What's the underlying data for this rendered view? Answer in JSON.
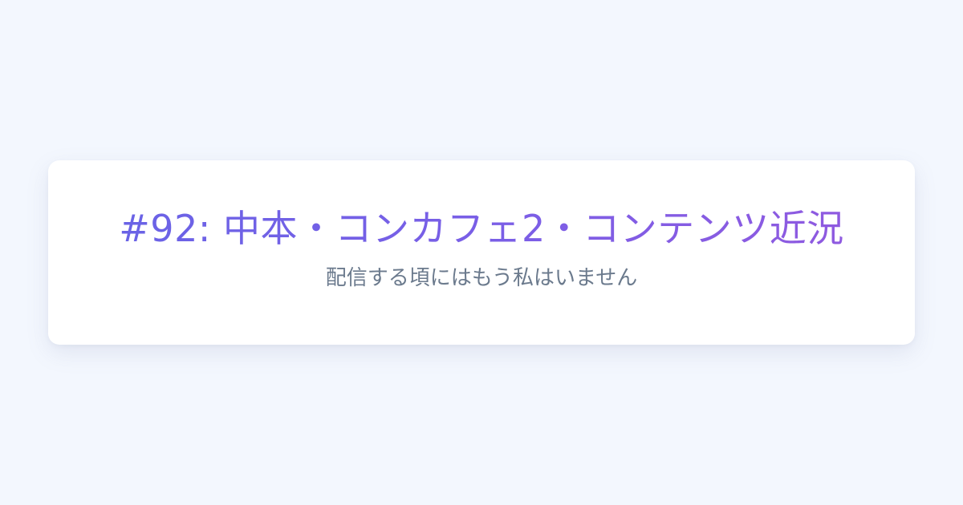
{
  "card": {
    "title": "#92: 中本・コンカフェ2・コンテンツ近況",
    "subtitle": "配信する頃にはもう私はいません"
  },
  "colors": {
    "background": "#f3f7fe",
    "card": "#ffffff",
    "title_gradient_start": "#6a63e6",
    "title_gradient_end": "#8f5ae0",
    "subtitle": "#6b7a8d"
  }
}
